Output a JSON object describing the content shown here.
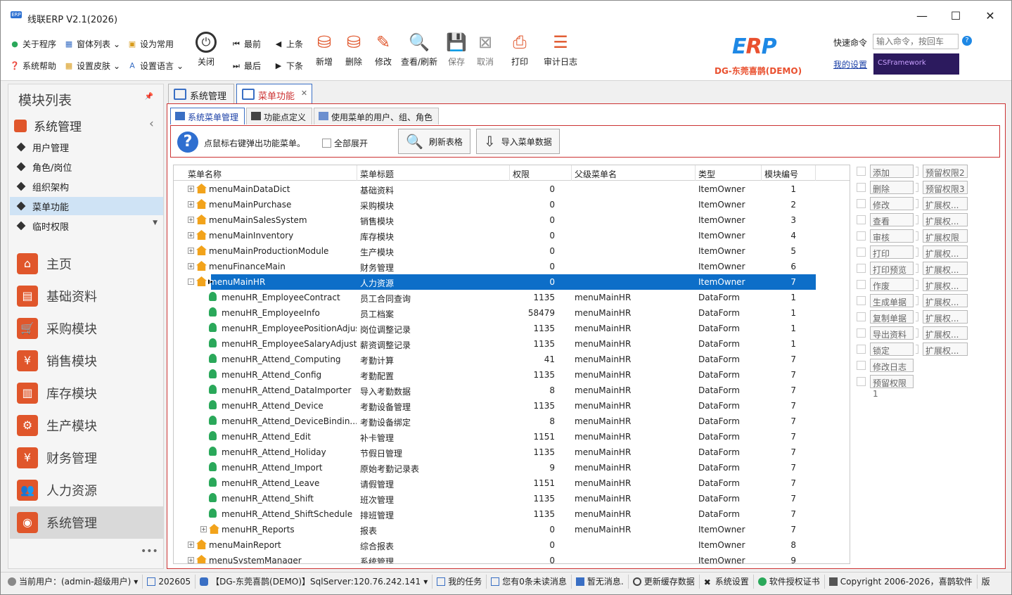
{
  "window": {
    "title": "线联ERP V2.1(2026)",
    "logo_text": "ERP",
    "minimize_icon": "minimize-icon",
    "maximize_icon": "maximize-icon",
    "close_icon": "close-icon"
  },
  "ribbon": {
    "small_buttons": [
      {
        "label": "关于程序",
        "icon": "info-icon"
      },
      {
        "label": "窗体列表",
        "icon": "window-list-icon"
      },
      {
        "label": "设为常用",
        "icon": "pin-icon"
      },
      {
        "label": "系统帮助",
        "icon": "help-icon"
      },
      {
        "label": "设置皮肤",
        "icon": "skin-icon"
      },
      {
        "label": "设置语言",
        "icon": "language-icon"
      }
    ],
    "close": "关闭",
    "nav": [
      {
        "label": "最前"
      },
      {
        "label": "上条"
      },
      {
        "label": "最后"
      },
      {
        "label": "下条"
      }
    ],
    "actions": [
      {
        "label": "新增",
        "icon": "add-db-icon",
        "enabled": true
      },
      {
        "label": "删除",
        "icon": "delete-db-icon",
        "enabled": true
      },
      {
        "label": "修改",
        "icon": "edit-db-icon",
        "enabled": true
      },
      {
        "label": "查看/刷新",
        "icon": "view-refresh-icon",
        "enabled": true
      },
      {
        "label": "保存",
        "icon": "save-icon",
        "enabled": false
      },
      {
        "label": "取消",
        "icon": "cancel-icon",
        "enabled": false
      },
      {
        "label": "打印",
        "icon": "print-icon",
        "enabled": true
      },
      {
        "label": "审计日志",
        "icon": "audit-log-icon",
        "enabled": true
      }
    ],
    "org_name": "DG-东莞喜鹊(DEMO)",
    "quick_command_label": "快速命令",
    "quick_command_placeholder": "输入命令，按回车",
    "my_settings": "我的设置",
    "brand_banner": "CSFramework"
  },
  "left_panel": {
    "title": "模块列表",
    "group": "系统管理",
    "sub_items": [
      {
        "label": "用户管理",
        "selected": false
      },
      {
        "label": "角色/岗位",
        "selected": false
      },
      {
        "label": "组织架构",
        "selected": false
      },
      {
        "label": "菜单功能",
        "selected": true
      },
      {
        "label": "临时权限",
        "selected": false
      }
    ],
    "nav_items": [
      {
        "label": "主页",
        "icon": "home-icon",
        "selected": false
      },
      {
        "label": "基础资料",
        "icon": "folder-icon",
        "selected": false
      },
      {
        "label": "采购模块",
        "icon": "cart-icon",
        "selected": false
      },
      {
        "label": "销售模块",
        "icon": "sales-bag-icon",
        "selected": false
      },
      {
        "label": "库存模块",
        "icon": "warehouse-icon",
        "selected": false
      },
      {
        "label": "生产模块",
        "icon": "gears-icon",
        "selected": false
      },
      {
        "label": "财务管理",
        "icon": "money-bag-icon",
        "selected": false
      },
      {
        "label": "人力资源",
        "icon": "people-icon",
        "selected": false
      },
      {
        "label": "系统管理",
        "icon": "system-icon",
        "selected": true
      }
    ],
    "more": "•••"
  },
  "doc_tabs": [
    {
      "label": "系统管理",
      "active": false
    },
    {
      "label": "菜单功能",
      "active": true
    }
  ],
  "sub_tabs": [
    {
      "label": "系统菜单管理",
      "active": true
    },
    {
      "label": "功能点定义",
      "active": false
    },
    {
      "label": "使用菜单的用户、组、角色",
      "active": false
    }
  ],
  "toolbar": {
    "tip": "点鼠标右键弹出功能菜单。",
    "expand_all": "全部展开",
    "refresh": "刷新表格",
    "import": "导入菜单数据"
  },
  "grid": {
    "columns": [
      "菜单名称",
      "菜单标题",
      "权限",
      "父级菜单名",
      "类型",
      "模块编号"
    ],
    "rows": [
      {
        "level": 0,
        "expander": "+",
        "icon": "house",
        "name": "menuMainDataDict",
        "title": "基础资料",
        "auth": "0",
        "parent": "",
        "type": "ItemOwner",
        "module": "1"
      },
      {
        "level": 0,
        "expander": "+",
        "icon": "house",
        "name": "menuMainPurchase",
        "title": "采购模块",
        "auth": "0",
        "parent": "",
        "type": "ItemOwner",
        "module": "2"
      },
      {
        "level": 0,
        "expander": "+",
        "icon": "house",
        "name": "menuMainSalesSystem",
        "title": "销售模块",
        "auth": "0",
        "parent": "",
        "type": "ItemOwner",
        "module": "3"
      },
      {
        "level": 0,
        "expander": "+",
        "icon": "house",
        "name": "menuMainInventory",
        "title": "库存模块",
        "auth": "0",
        "parent": "",
        "type": "ItemOwner",
        "module": "4"
      },
      {
        "level": 0,
        "expander": "+",
        "icon": "house",
        "name": "menuMainProductionModule",
        "title": "生产模块",
        "auth": "0",
        "parent": "",
        "type": "ItemOwner",
        "module": "5"
      },
      {
        "level": 0,
        "expander": "+",
        "icon": "house",
        "name": "menuFinanceMain",
        "title": "财务管理",
        "auth": "0",
        "parent": "",
        "type": "ItemOwner",
        "module": "6"
      },
      {
        "level": 0,
        "expander": "-",
        "icon": "house",
        "name": "menuMainHR",
        "title": "人力资源",
        "auth": "0",
        "parent": "",
        "type": "ItemOwner",
        "module": "7",
        "selected": true
      },
      {
        "level": 1,
        "expander": "",
        "icon": "user",
        "name": "menuHR_EmployeeContract",
        "title": "员工合同查询",
        "auth": "1135",
        "parent": "menuMainHR",
        "type": "DataForm",
        "module": "1"
      },
      {
        "level": 1,
        "expander": "",
        "icon": "user",
        "name": "menuHR_EmployeeInfo",
        "title": "员工档案",
        "auth": "58479",
        "parent": "menuMainHR",
        "type": "DataForm",
        "module": "1"
      },
      {
        "level": 1,
        "expander": "",
        "icon": "user",
        "name": "menuHR_EmployeePositionAdjust",
        "title": "岗位调整记录",
        "auth": "1135",
        "parent": "menuMainHR",
        "type": "DataForm",
        "module": "1"
      },
      {
        "level": 1,
        "expander": "",
        "icon": "user",
        "name": "menuHR_EmployeeSalaryAdjust",
        "title": "薪资调整记录",
        "auth": "1135",
        "parent": "menuMainHR",
        "type": "DataForm",
        "module": "1"
      },
      {
        "level": 1,
        "expander": "",
        "icon": "user",
        "name": "menuHR_Attend_Computing",
        "title": "考勤计算",
        "auth": "41",
        "parent": "menuMainHR",
        "type": "DataForm",
        "module": "7"
      },
      {
        "level": 1,
        "expander": "",
        "icon": "user",
        "name": "menuHR_Attend_Config",
        "title": "考勤配置",
        "auth": "1135",
        "parent": "menuMainHR",
        "type": "DataForm",
        "module": "7"
      },
      {
        "level": 1,
        "expander": "",
        "icon": "user",
        "name": "menuHR_Attend_DataImporter",
        "title": "导入考勤数据",
        "auth": "8",
        "parent": "menuMainHR",
        "type": "DataForm",
        "module": "7"
      },
      {
        "level": 1,
        "expander": "",
        "icon": "user",
        "name": "menuHR_Attend_Device",
        "title": "考勤设备管理",
        "auth": "1135",
        "parent": "menuMainHR",
        "type": "DataForm",
        "module": "7"
      },
      {
        "level": 1,
        "expander": "",
        "icon": "user",
        "name": "menuHR_Attend_DeviceBindin...",
        "title": "考勤设备绑定",
        "auth": "8",
        "parent": "menuMainHR",
        "type": "DataForm",
        "module": "7"
      },
      {
        "level": 1,
        "expander": "",
        "icon": "user",
        "name": "menuHR_Attend_Edit",
        "title": "补卡管理",
        "auth": "1151",
        "parent": "menuMainHR",
        "type": "DataForm",
        "module": "7"
      },
      {
        "level": 1,
        "expander": "",
        "icon": "user",
        "name": "menuHR_Attend_Holiday",
        "title": "节假日管理",
        "auth": "1135",
        "parent": "menuMainHR",
        "type": "DataForm",
        "module": "7"
      },
      {
        "level": 1,
        "expander": "",
        "icon": "user",
        "name": "menuHR_Attend_Import",
        "title": "原始考勤记录表",
        "auth": "9",
        "parent": "menuMainHR",
        "type": "DataForm",
        "module": "7"
      },
      {
        "level": 1,
        "expander": "",
        "icon": "user",
        "name": "menuHR_Attend_Leave",
        "title": "请假管理",
        "auth": "1151",
        "parent": "menuMainHR",
        "type": "DataForm",
        "module": "7"
      },
      {
        "level": 1,
        "expander": "",
        "icon": "user",
        "name": "menuHR_Attend_Shift",
        "title": "班次管理",
        "auth": "1135",
        "parent": "menuMainHR",
        "type": "DataForm",
        "module": "7"
      },
      {
        "level": 1,
        "expander": "",
        "icon": "user",
        "name": "menuHR_Attend_ShiftSchedule",
        "title": "排班管理",
        "auth": "1135",
        "parent": "menuMainHR",
        "type": "DataForm",
        "module": "7"
      },
      {
        "level": 1,
        "expander": "+",
        "icon": "house",
        "name": "menuHR_Reports",
        "title": "报表",
        "auth": "0",
        "parent": "menuMainHR",
        "type": "ItemOwner",
        "module": "7"
      },
      {
        "level": 0,
        "expander": "+",
        "icon": "house",
        "name": "menuMainReport",
        "title": "综合报表",
        "auth": "0",
        "parent": "",
        "type": "ItemOwner",
        "module": "8"
      },
      {
        "level": 0,
        "expander": "+",
        "icon": "house",
        "name": "menuSystemManager",
        "title": "系统管理",
        "auth": "0",
        "parent": "",
        "type": "ItemOwner",
        "module": "9"
      }
    ]
  },
  "permissions": {
    "left": [
      "添加",
      "删除",
      "修改",
      "查看",
      "审核",
      "打印",
      "打印预览",
      "作废",
      "生成单据",
      "复制单据",
      "导出资料",
      "锁定",
      "修改日志",
      "预留权限1"
    ],
    "right": [
      "预留权限2",
      "预留权限3",
      "扩展权...",
      "扩展权...",
      "扩展权限",
      "扩展权...",
      "扩展权...",
      "扩展权...",
      "扩展权...",
      "扩展权...",
      "扩展权...",
      "扩展权..."
    ]
  },
  "status": {
    "user": "当前用户：(admin-超级用户)",
    "period": "202605",
    "db": "【DG-东莞喜鹊(DEMO)】SqlServer:120.76.242.141",
    "tasks": "我的任务",
    "unread": "您有0条未读消息",
    "msg": "暂无消息.",
    "refresh_cache": "更新缓存数据",
    "sys_settings": "系统设置",
    "license": "软件授权证书",
    "copyright": "Copyright 2006-2026，喜鹊软件",
    "version": "版"
  }
}
